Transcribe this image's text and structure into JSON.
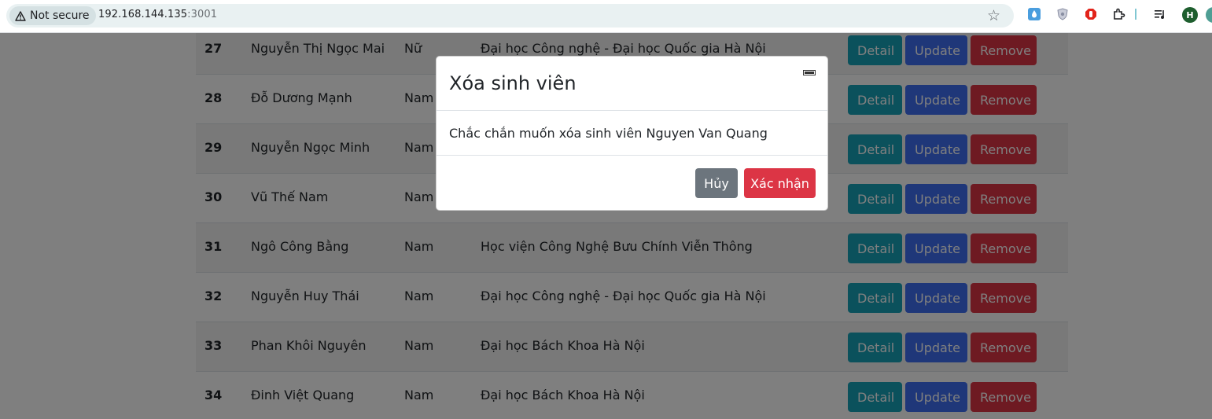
{
  "browser": {
    "security_label": "Not secure",
    "url_host": "192.168.144.135",
    "url_port": ":3001",
    "profile_initial": "H"
  },
  "table": {
    "buttons": {
      "detail": "Detail",
      "update": "Update",
      "remove": "Remove"
    },
    "rows": [
      {
        "id": "27",
        "name": "Nguyễn Thị Ngọc Mai",
        "gender": "Nữ",
        "school": "Đại học Công nghệ - Đại học Quốc gia Hà Nội"
      },
      {
        "id": "28",
        "name": "Đỗ Dương Mạnh",
        "gender": "Nam",
        "school": ""
      },
      {
        "id": "29",
        "name": "Nguyễn Ngọc Minh",
        "gender": "Nam",
        "school": ""
      },
      {
        "id": "30",
        "name": "Vũ Thế Nam",
        "gender": "Nam",
        "school": ""
      },
      {
        "id": "31",
        "name": "Ngô Công Bằng",
        "gender": "Nam",
        "school": "Học viện Công Nghệ Bưu Chính Viễn Thông"
      },
      {
        "id": "32",
        "name": "Nguyễn Huy Thái",
        "gender": "Nam",
        "school": "Đại học Công nghệ - Đại học Quốc gia Hà Nội"
      },
      {
        "id": "33",
        "name": "Phan Khôi Nguyên",
        "gender": "Nam",
        "school": "Đại học Bách Khoa Hà Nội"
      },
      {
        "id": "34",
        "name": "Đinh Việt Quang",
        "gender": "Nam",
        "school": "Đại học Bách Khoa Hà Nội"
      }
    ]
  },
  "modal": {
    "title": "Xóa sinh viên",
    "message": "Chắc chắn muốn xóa sinh viên Nguyen Van Quang",
    "cancel_label": "Hủy",
    "confirm_label": "Xác nhận"
  }
}
